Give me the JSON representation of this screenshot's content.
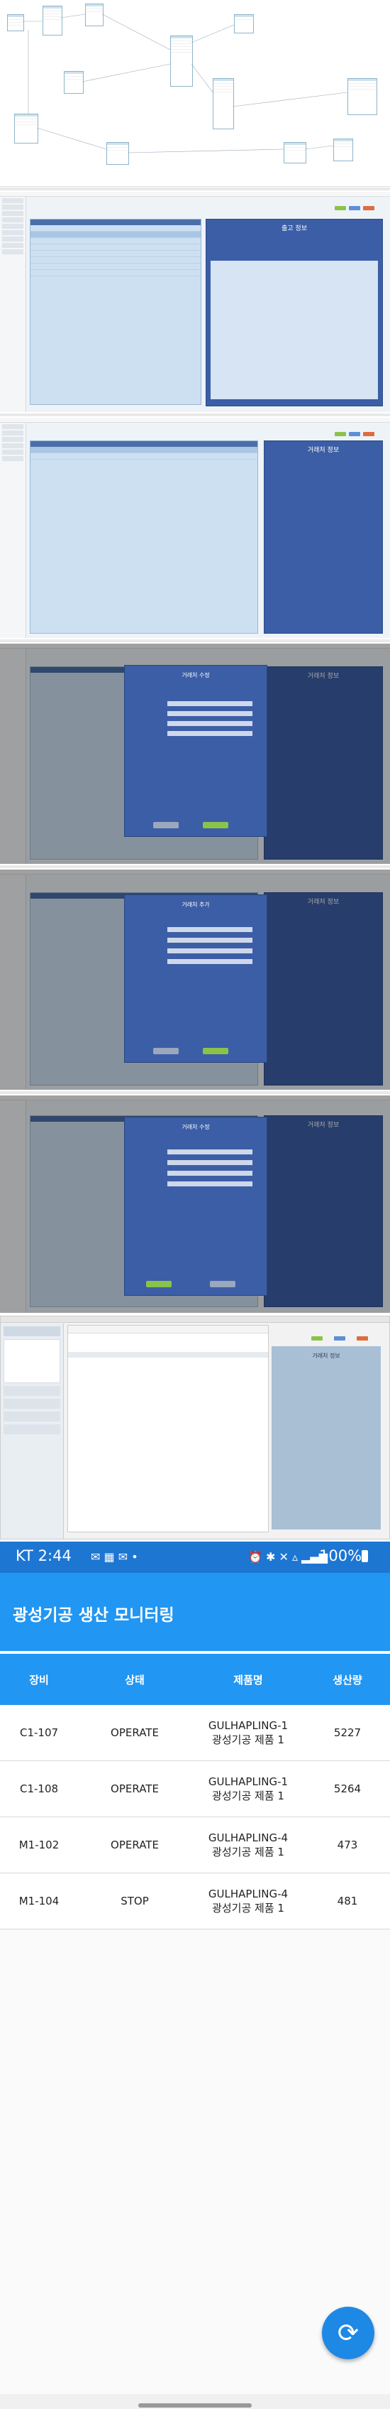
{
  "phone": {
    "status": {
      "time": "KT 2:44",
      "battery": "100%"
    },
    "app_title": "광성기공 생산 모니터링",
    "columns": [
      "장비",
      "상태",
      "제품명",
      "생산량"
    ],
    "rows": [
      {
        "equip": "C1-107",
        "state": "OPERATE",
        "product_line1": "GULHAPLING-1",
        "product_line2": "광성기공 제품 1",
        "qty": "5227"
      },
      {
        "equip": "C1-108",
        "state": "OPERATE",
        "product_line1": "GULHAPLING-1",
        "product_line2": "광성기공 제품 1",
        "qty": "5264"
      },
      {
        "equip": "M1-102",
        "state": "OPERATE",
        "product_line1": "GULHAPLING-4",
        "product_line2": "광성기공 제품 1",
        "qty": "473"
      },
      {
        "equip": "M1-104",
        "state": "STOP",
        "product_line1": "GULHAPLING-4",
        "product_line2": "광성기공 제품 1",
        "qty": "481"
      }
    ],
    "refresh_icon": "refresh-icon"
  },
  "screens": {
    "shipment_title": "출고 정보",
    "client_info_title": "거래처 정보",
    "dialog_edit_title": "거래처 수정",
    "dialog_add_title": "거래처 추가"
  },
  "colors": {
    "app_blue": "#2196f3",
    "status_blue": "#1d76d2",
    "panel_blue": "#3c5ea6"
  }
}
